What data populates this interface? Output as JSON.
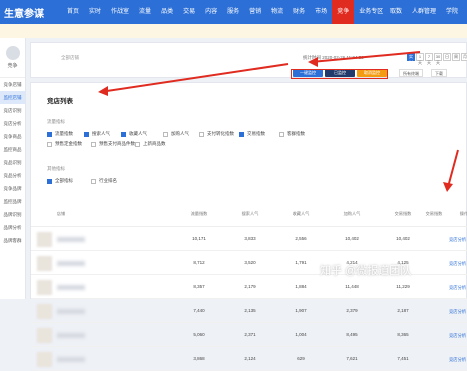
{
  "topbar": {
    "app_title": "生意参谋",
    "nav": [
      "首页",
      "实时",
      "作战室",
      "流量",
      "品类",
      "交易",
      "内容",
      "服务",
      "营销",
      "物流",
      "财务",
      "市场",
      "竞争",
      "业务专区"
    ],
    "active_nav": "竞争",
    "right_nav": [
      "取数",
      "人群管理",
      "学院"
    ]
  },
  "sidebar": {
    "top_label": "竞争",
    "items": [
      "竞争店铺",
      "监控店铺",
      "竞店识别",
      "竞店分析",
      "竞争商品",
      "监控商品",
      "竞品识别",
      "竞品分析",
      "竞争品牌",
      "监控品牌",
      "品牌识别",
      "品牌分析",
      "品牌客群"
    ],
    "active_index": 1
  },
  "filterbar": {
    "placeholder": "全部店铺",
    "date": "统计时间 2020-02-26 11:04:52",
    "btn_blue": "一键监控",
    "btn_dark": "已监控",
    "btn_orange": "取消监控",
    "ops": [
      "实时",
      "1天",
      "7天",
      "30天",
      "日",
      "周",
      "月"
    ],
    "more": "所有终端",
    "download": "下载"
  },
  "panel": {
    "title": "竞店列表",
    "section1": "流量指标",
    "section2": "其他指标",
    "checkboxes": [
      {
        "label": "流量指数",
        "on": true
      },
      {
        "label": "搜索人气",
        "on": true
      },
      {
        "label": "收藏人气",
        "on": true
      },
      {
        "label": "加购人气",
        "on": false
      },
      {
        "label": "支付转化指数",
        "on": false
      },
      {
        "label": "交易指数",
        "on": true
      },
      {
        "label": "客群指数",
        "on": false
      },
      {
        "label": "预售定金指数",
        "on": false
      },
      {
        "label": "预售支付商品件数",
        "on": false
      },
      {
        "label": "上新商品数",
        "on": false
      },
      {
        "label": "全部指标",
        "on": true
      },
      {
        "label": "行业排名",
        "on": false
      }
    ]
  },
  "table": {
    "headers": [
      "店铺",
      "流量指数",
      "搜索人气",
      "收藏人气",
      "加购人气",
      "交易指数",
      "交易指数",
      "操作"
    ],
    "rows": [
      [
        "10,171",
        "3,833",
        "2,556",
        "10,402",
        "10,402",
        "竞店分析"
      ],
      [
        "8,712",
        "3,520",
        "1,791",
        "4,214",
        "4,125",
        "竞店分析"
      ],
      [
        "8,357",
        "2,179",
        "1,884",
        "11,448",
        "11,229",
        "竞店分析"
      ],
      [
        "7,440",
        "2,135",
        "1,907",
        "2,379",
        "2,187",
        "竞店分析"
      ],
      [
        "5,060",
        "2,371",
        "1,004",
        "8,495",
        "8,365",
        "竞店分析"
      ],
      [
        "3,868",
        "2,124",
        "629",
        "7,621",
        "7,451",
        "竞店分析"
      ]
    ]
  },
  "watermark": "知乎 @微报道团队"
}
